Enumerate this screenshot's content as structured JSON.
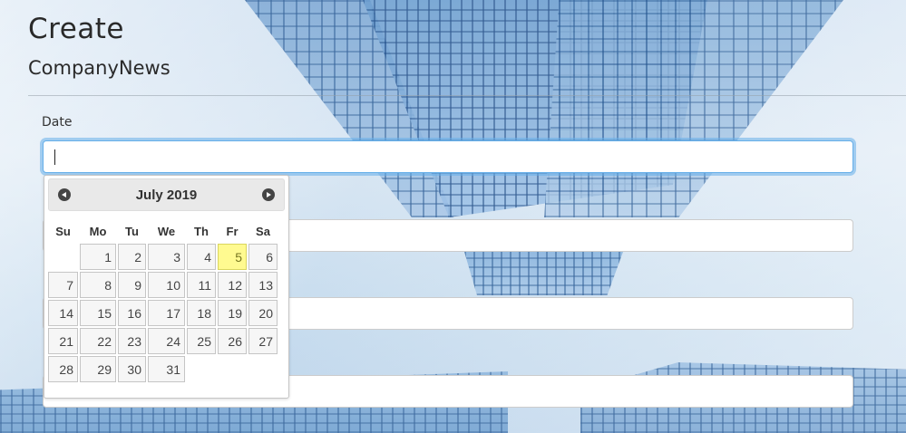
{
  "page": {
    "title": "Create",
    "subtitle": "CompanyNews"
  },
  "form": {
    "date_label": "Date",
    "date_value": "",
    "other_fields": [
      {
        "value": ""
      },
      {
        "value": ""
      },
      {
        "value": ""
      }
    ]
  },
  "datepicker": {
    "month_title": "July 2019",
    "prev_icon": "circle-triangle-w-icon",
    "next_icon": "circle-triangle-e-icon",
    "weekdays": [
      "Su",
      "Mo",
      "Tu",
      "We",
      "Th",
      "Fr",
      "Sa"
    ],
    "weeks": [
      [
        "",
        "1",
        "2",
        "3",
        "4",
        "5",
        "6"
      ],
      [
        "7",
        "8",
        "9",
        "10",
        "11",
        "12",
        "13"
      ],
      [
        "14",
        "15",
        "16",
        "17",
        "18",
        "19",
        "20"
      ],
      [
        "21",
        "22",
        "23",
        "24",
        "25",
        "26",
        "27"
      ],
      [
        "28",
        "29",
        "30",
        "31",
        "",
        "",
        ""
      ]
    ],
    "highlighted_day": "5",
    "colors": {
      "highlight_bg": "#fffa90",
      "highlight_border": "#dad55e",
      "day_bg": "#f6f6f6",
      "focus_ring": "#66afe9"
    }
  }
}
